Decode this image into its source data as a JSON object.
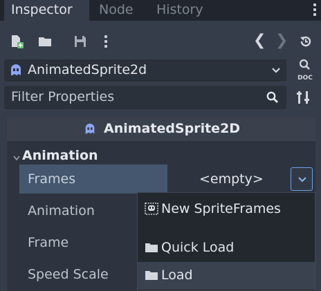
{
  "tabs": [
    {
      "label": "Inspector",
      "active": true
    },
    {
      "label": "Node",
      "active": false
    },
    {
      "label": "History",
      "active": false
    }
  ],
  "toolbar": {
    "icons": [
      "new-resource-icon",
      "load-folder-icon",
      "save-icon",
      "more-menu-icon"
    ],
    "prev": "❮",
    "next": "❯"
  },
  "object_selector": {
    "label": "AnimatedSprite2d"
  },
  "filter": {
    "placeholder": "Filter Properties"
  },
  "panel": {
    "header": "AnimatedSprite2D",
    "section": "Animation",
    "properties": {
      "frames_label": "Frames",
      "frames_value": "<empty>",
      "animation_label": "Animation",
      "frame_label": "Frame",
      "speed_scale_label": "Speed Scale"
    }
  },
  "dropdown_menu": {
    "items": [
      {
        "label": "New SpriteFrames"
      },
      {
        "label": "Quick Load"
      },
      {
        "label": "Load",
        "hovered": true
      }
    ]
  },
  "colors": {
    "background": "#363d4a",
    "accent": "#6aa3e6",
    "node_icon": "#8da5f3"
  }
}
